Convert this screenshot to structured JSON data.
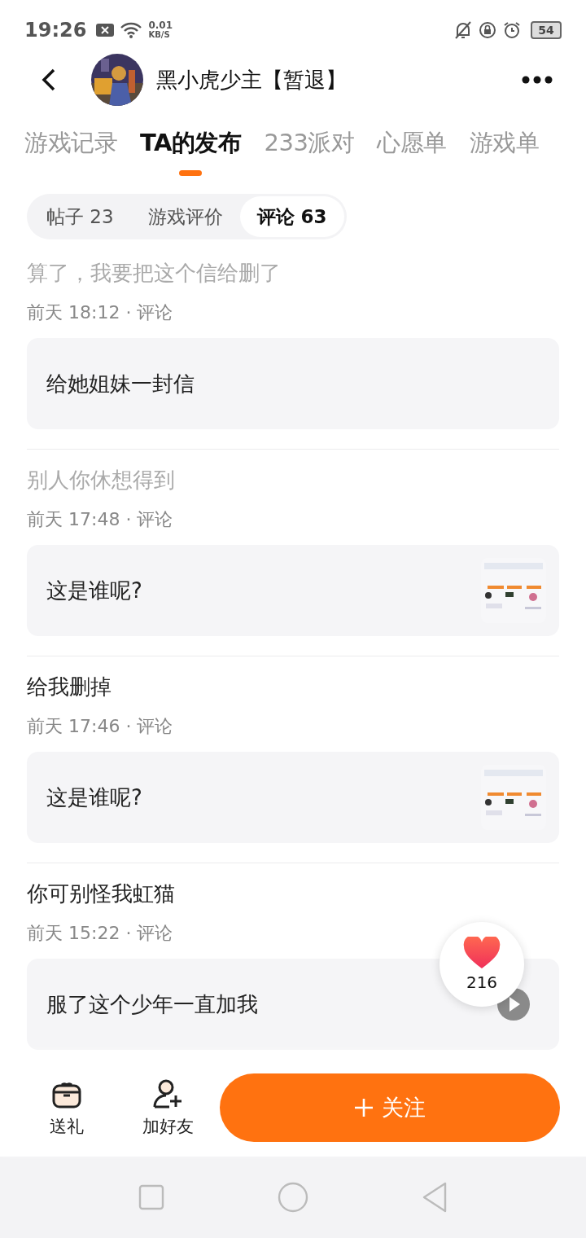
{
  "status_bar": {
    "time": "19:26",
    "speed": "0.01",
    "speed_unit": "KB/S",
    "battery": "54"
  },
  "header": {
    "name": "黑小虎少主【暂退】"
  },
  "tabs": [
    {
      "label": "游戏记录",
      "selected": false
    },
    {
      "label": "TA的发布",
      "selected": true
    },
    {
      "label": "233派对",
      "selected": false
    },
    {
      "label": "心愿单",
      "selected": false
    },
    {
      "label": "游戏单",
      "selected": false
    }
  ],
  "subtabs": [
    {
      "label": "帖子 23",
      "selected": false
    },
    {
      "label": "游戏评价",
      "selected": false
    },
    {
      "label": "评论 63",
      "selected": true
    }
  ],
  "comments": [
    {
      "title": "算了，我要把这个信给删了",
      "muted": true,
      "meta": "前天 18:12 · 评论",
      "body": "给她姐妹一封信"
    },
    {
      "title": "别人你休想得到",
      "muted": true,
      "meta": "前天 17:48 · 评论",
      "body": "这是谁呢?",
      "kind": "picture"
    },
    {
      "title": "给我删掉",
      "muted": false,
      "meta": "前天 17:46 · 评论",
      "body": "这是谁呢?",
      "kind": "picture"
    },
    {
      "title": "你可别怪我虹猫",
      "muted": false,
      "meta": "前天 15:22 · 评论",
      "body": "服了这个少年一直加我",
      "kind": "video"
    }
  ],
  "like": {
    "count": "216"
  },
  "actions": [
    {
      "label": "送礼",
      "kind": "gift"
    },
    {
      "label": "加好友",
      "kind": "add-friend"
    }
  ],
  "follow": {
    "label": "关注"
  }
}
